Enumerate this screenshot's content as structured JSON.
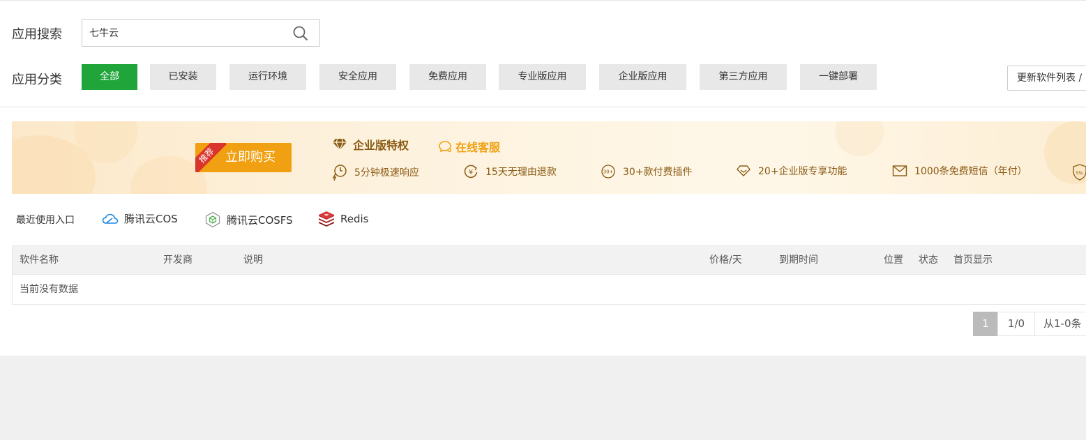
{
  "search": {
    "label": "应用搜索",
    "value": "七牛云"
  },
  "categories": {
    "label": "应用分类",
    "items": [
      {
        "label": "全部",
        "active": true
      },
      {
        "label": "已安装"
      },
      {
        "label": "运行环境"
      },
      {
        "label": "安全应用"
      },
      {
        "label": "免费应用"
      },
      {
        "label": "专业版应用"
      },
      {
        "label": "企业版应用"
      },
      {
        "label": "第三方应用"
      },
      {
        "label": "一键部署"
      }
    ],
    "update_button": "更新软件列表 /"
  },
  "banner": {
    "ribbon": "推荐",
    "buy_button": "立即购买",
    "enterprise_title": "企业版特权",
    "online_service": "在线客服",
    "features": [
      {
        "icon": "fast-response-icon",
        "text": "5分钟极速响应"
      },
      {
        "icon": "refund-icon",
        "text": "15天无理由退款"
      },
      {
        "icon": "plugins-icon",
        "text": "30+款付费插件",
        "badge": "30+"
      },
      {
        "icon": "diamond-feature-icon",
        "text": "20+企业版专享功能"
      },
      {
        "icon": "sms-icon",
        "text": "1000条免费短信（年付）"
      }
    ],
    "ssl_badge": "SSL",
    "accent_color": "#f0a010",
    "text_color": "#8a5a12"
  },
  "recent": {
    "label": "最近使用入口",
    "items": [
      {
        "icon": "tencent-cloud-icon",
        "label": "腾讯云COS"
      },
      {
        "icon": "cosfs-cube-icon",
        "label": "腾讯云COSFS"
      },
      {
        "icon": "redis-icon",
        "label": "Redis"
      }
    ]
  },
  "table": {
    "columns": [
      "软件名称",
      "开发商",
      "说明",
      "价格/天",
      "到期时间",
      "位置",
      "状态",
      "首页显示"
    ],
    "empty_text": "当前没有数据"
  },
  "pagination": {
    "current": "1",
    "pages": "1/0",
    "range": "从1-0条"
  },
  "colors": {
    "brand_green": "#20a53a"
  }
}
